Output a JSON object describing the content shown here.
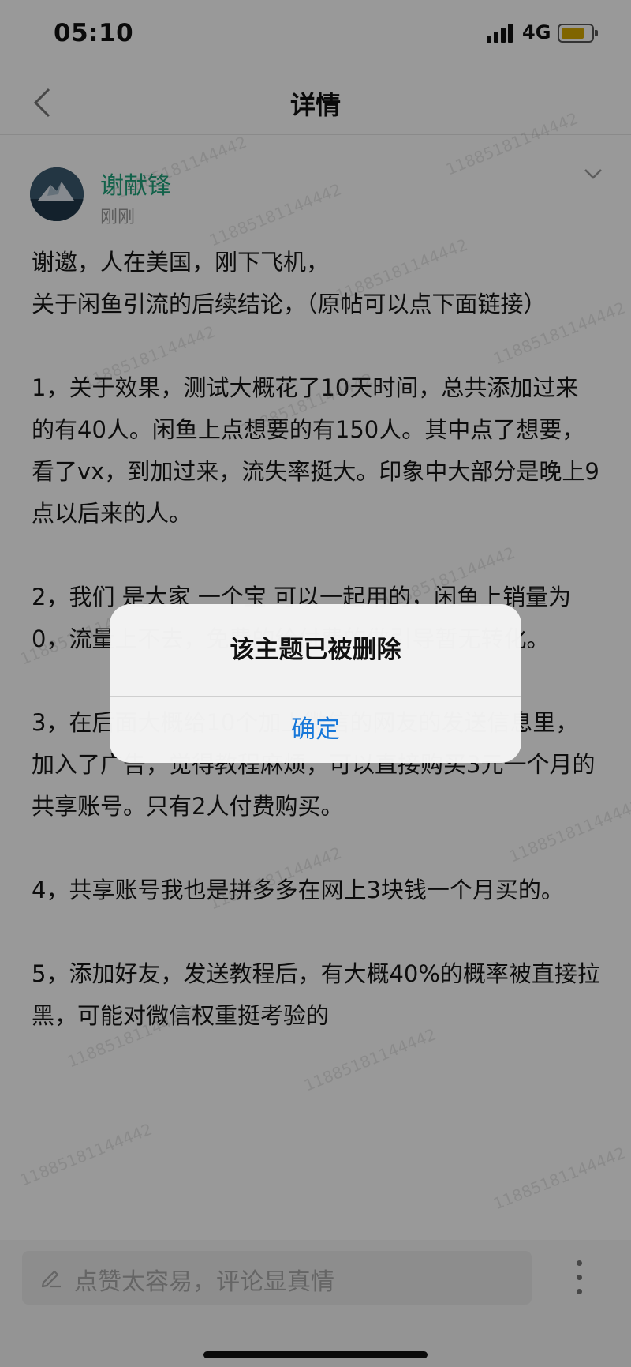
{
  "status_bar": {
    "time": "05:10",
    "network": "4G"
  },
  "nav": {
    "title": "详情"
  },
  "post": {
    "author": "谢献锋",
    "time": "刚刚",
    "paragraphs": [
      "谢邀，人在美国，刚下飞机，\n关于闲鱼引流的后续结论，（原帖可以点下面链接）",
      "1，关于效果，测试大概花了10天时间，总共添加过来的有40人。闲鱼上点想要的有150人。其中点了想要，看了vx，到加过来，流失率挺大。印象中大部分是晚上9点以后来的人。",
      "2，我们 是大家 一个宝 可以一起用的，闲鱼上销量为0，流量上不去，免费的给付费的做引导暂无转化。",
      "3，在后面大概给10个加上微信的网友的发送信息里，加入了广告，觉得教程麻烦，可以直接购买3元一个月的共享账号。只有2人付费购买。",
      "4，共享账号我也是拼多多在网上3块钱一个月买的。",
      "5，添加好友，发送教程后，有大概40%的概率被直接拉黑，可能对微信权重挺考验的"
    ]
  },
  "comment_bar": {
    "placeholder": "点赞太容易，评论显真情"
  },
  "dialog": {
    "message": "该主题已被删除",
    "confirm_label": "确定"
  },
  "watermark_text": "11885181144442",
  "colors": {
    "author": "#1fa37c",
    "dialog_button": "#1677d9",
    "battery": "#d6a800"
  },
  "icons": [
    "back-icon",
    "chevron-down-icon",
    "pen-icon",
    "more-icon"
  ]
}
